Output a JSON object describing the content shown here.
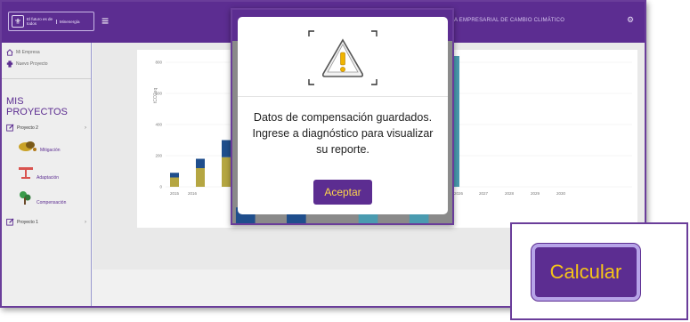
{
  "header": {
    "logo_text": "El futuro es de todos",
    "logo_badge": "Minenergía",
    "menu_icon": "hamburger-icon",
    "title": "A EMPRESARIAL DE CAMBIO CLIMÁTICO",
    "settings_icon": "gear-icon"
  },
  "sidebar": {
    "link_home": "Mi Empresa",
    "link_new_project": "Nuevo Proyecto",
    "section_title": "MIS PROYECTOS",
    "projects": [
      {
        "label": "Proyecto 2"
      },
      {
        "label": "Proyecto 1"
      }
    ],
    "sub_items": [
      {
        "label": "Mitigación",
        "icon": "mitigation-icon"
      },
      {
        "label": "Adaptación",
        "icon": "adaptation-icon"
      },
      {
        "label": "Compensación",
        "icon": "compensation-icon"
      }
    ]
  },
  "chart_data": {
    "type": "bar",
    "ylabel": "tCO2eq",
    "yticks": [
      "0",
      "200",
      "400",
      "600",
      "800"
    ],
    "xticks_left": [
      "2015",
      "2016"
    ],
    "xticks_right": [
      "2026",
      "2027",
      "2028",
      "2029",
      "2030"
    ],
    "ylim": [
      0,
      800
    ],
    "series_colors": {
      "blue": "#1f4e8c",
      "olive": "#b5a642",
      "teal": "#4a9bb0"
    },
    "stacks": [
      {
        "x": "2015",
        "blue": 30,
        "olive": 60
      },
      {
        "x": "2016",
        "blue": 60,
        "olive": 120
      },
      {
        "x": "2017",
        "blue": 110,
        "olive": 190
      },
      {
        "x": "2026",
        "teal": 840
      }
    ]
  },
  "modal": {
    "warning_icon": "warning-icon",
    "message": "Datos de compensación guardados. Ingrese a diagnóstico para visualizar su reporte.",
    "accept_label": "Aceptar"
  },
  "callout": {
    "calc_label": "Calcular"
  },
  "colors": {
    "primary": "#5c2d91",
    "accent_text": "#f5c518"
  }
}
